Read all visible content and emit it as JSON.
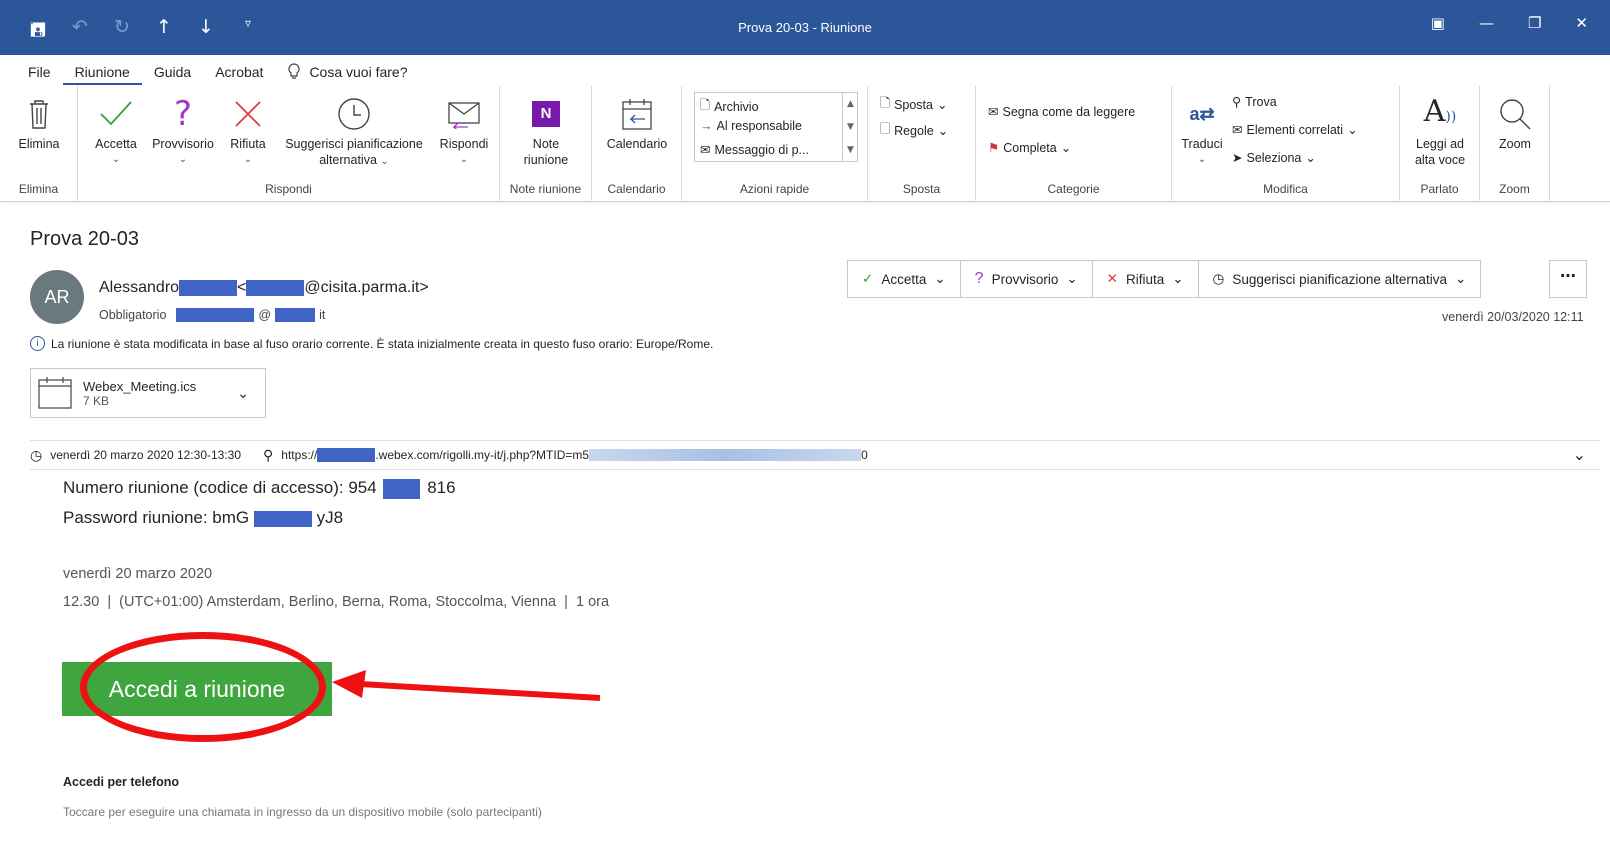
{
  "window": {
    "title": "Prova 20-03  -  Riunione"
  },
  "tabs": [
    "File",
    "Riunione",
    "Guida",
    "Acrobat"
  ],
  "tell_me": "Cosa vuoi fare?",
  "ribbon": {
    "elimina": {
      "button": "Elimina",
      "group": "Elimina"
    },
    "rispondi": {
      "group": "Rispondi",
      "accetta": "Accetta",
      "provvisorio": "Provvisorio",
      "rifiuta": "Rifiuta",
      "suggerisci_1": "Suggerisci pianificazione",
      "suggerisci_2": "alternativa",
      "rispondi": "Rispondi"
    },
    "note": {
      "line1": "Note",
      "line2": "riunione",
      "group": "Note riunione"
    },
    "calendario": {
      "button": "Calendario",
      "group": "Calendario"
    },
    "azioni_rapide": {
      "group": "Azioni rapide",
      "items": [
        "Archivio",
        "Al responsabile",
        "Messaggio di p..."
      ]
    },
    "sposta": {
      "group": "Sposta",
      "sposta": "Sposta",
      "regole": "Regole"
    },
    "categorie": {
      "group": "Categorie",
      "segna": "Segna come da leggere",
      "completa": "Completa"
    },
    "modifica": {
      "group": "Modifica",
      "traduci": "Traduci",
      "trova": "Trova",
      "elementi": "Elementi correlati",
      "seleziona": "Seleziona"
    },
    "parlato": {
      "group": "Parlato",
      "line1": "Leggi ad",
      "line2": "alta voce"
    },
    "zoom": {
      "group": "Zoom",
      "button": "Zoom"
    }
  },
  "message": {
    "subject": "Prova 20-03",
    "avatar_initials": "AR",
    "sender_name": "Alessandro",
    "sender_email_domain": "@cisita.parma.it>",
    "required_label": "Obbligatorio",
    "recipient_at": "@",
    "recipient_tld": "it",
    "date": "venerdì 20/03/2020 12:11",
    "info_text": "La riunione è stata modificata in base al fuso orario corrente. È stata inizialmente creata in questo fuso orario: Europe/Rome.",
    "responses": {
      "accetta": "Accetta",
      "provvisorio": "Provvisorio",
      "rifiuta": "Rifiuta",
      "suggerisci": "Suggerisci pianificazione alternativa"
    },
    "attachment": {
      "name": "Webex_Meeting.ics",
      "size": "7 KB"
    },
    "when": "venerdì 20 marzo 2020 12:30-13:30",
    "where_prefix": "https://",
    "where_suffix": ".webex.com/rigolli.my-it/j.php?MTID=m5",
    "where_end": "0"
  },
  "body": {
    "numero_label": "Numero riunione (codice di accesso): 954",
    "numero_end": "816",
    "password_label": "Password riunione: bmG",
    "password_end": "yJ8",
    "day": "venerdì 20 marzo 2020",
    "time": "12.30  |  (UTC+01:00) Amsterdam, Berlino, Berna, Roma, Stoccolma, Vienna  |  1 ora",
    "join_button": "Accedi a riunione",
    "phone_title": "Accedi per telefono",
    "phone_text": "Toccare per eseguire una chiamata in ingresso da un dispositivo mobile (solo partecipanti)"
  },
  "colors": {
    "titlebar": "#2b579a",
    "join_button": "#3fa63f",
    "annotation": "#e11111",
    "redaction": "#3f64c6"
  }
}
